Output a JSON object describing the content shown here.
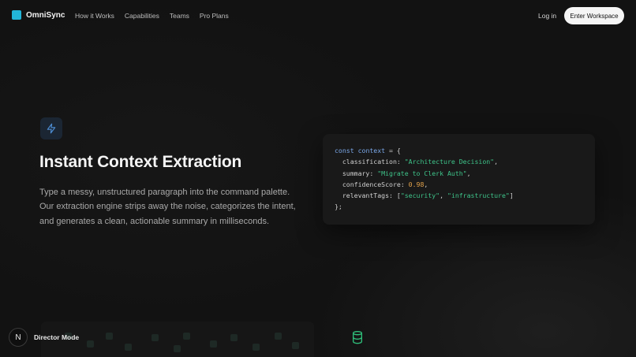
{
  "nav": {
    "brand": "OmniSync",
    "links": [
      "How it Works",
      "Capabilities",
      "Teams",
      "Pro Plans"
    ],
    "login": "Log in",
    "cta": "Enter Workspace"
  },
  "hero": {
    "icon": "bolt-icon",
    "title": "Instant Context Extraction",
    "description": "Type a messy, unstructured paragraph into the command palette. Our extraction engine strips away the noise, categorizes the intent, and generates a clean, actionable summary in milliseconds."
  },
  "code": {
    "keyword": "const",
    "var_name": "context",
    "open": "= {",
    "close": "};",
    "fields": [
      {
        "key": "classification",
        "value": "\"Architecture Decision\"",
        "kind": "str",
        "suffix": ","
      },
      {
        "key": "summary",
        "value": "\"Migrate to Clerk Auth\"",
        "kind": "str",
        "suffix": ","
      },
      {
        "key": "confidenceScore",
        "value": "0.98",
        "kind": "num",
        "suffix": ","
      },
      {
        "key": "relevantTags",
        "value_tags": [
          "\"security\"",
          "\"infrastructure\""
        ]
      }
    ]
  },
  "bottom": {
    "director_initial": "N",
    "director_label": "Director Mode",
    "icon": "database-icon"
  },
  "colors": {
    "brand": "#22b5d8",
    "bolt": "#4e8fd6",
    "code_string": "#3ec48a",
    "code_number": "#e2a24a",
    "code_keyword": "#7aa7e8",
    "db_icon": "#2fbf7a"
  }
}
